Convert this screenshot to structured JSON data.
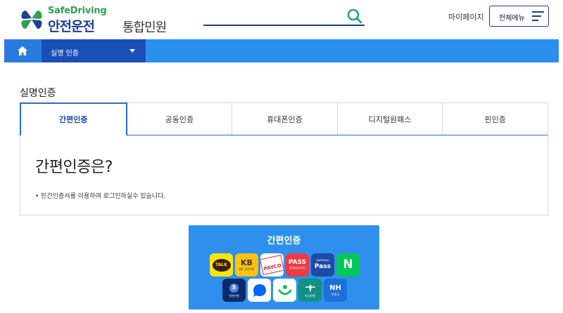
{
  "header": {
    "logo_en": "SafeDriving",
    "logo_ko": "안전운전",
    "logo_sub": "통합민원",
    "mypage_label": "마이페이지",
    "allmenu_label": "전체메뉴"
  },
  "nav": {
    "breadcrumb_label": "실명 인증"
  },
  "page": {
    "title": "실명인증"
  },
  "tabs": [
    {
      "label": "간편인증",
      "active": true
    },
    {
      "label": "공동인증",
      "active": false
    },
    {
      "label": "휴대폰인증",
      "active": false
    },
    {
      "label": "디지털원패스",
      "active": false
    },
    {
      "label": "핀인증",
      "active": false
    }
  ],
  "content": {
    "title": "간편인증은?",
    "desc": "• 민간인증서를 이용하여 로그인하실수 있습니다."
  },
  "panel": {
    "title": "간편인증",
    "apps": [
      {
        "name": "kakao-talk",
        "text": "TALK",
        "bg": "#fee500",
        "fg": "#3c1e1e"
      },
      {
        "name": "kb",
        "text": "KB",
        "sub": "KB 국민은행",
        "bg": "#ffc20e",
        "fg": "#3a3a3a"
      },
      {
        "name": "payco",
        "text": "PAYCO",
        "bg": "#ffffff",
        "fg": "#e52a2a"
      },
      {
        "name": "pass",
        "text": "PASS",
        "sub": "휴대폰본인확인",
        "bg": "#ef3a45",
        "fg": "#ffffff"
      },
      {
        "name": "samsung-pass",
        "text": "Pass",
        "sub": "SAMSUNG",
        "bg": "#1f4aa8",
        "fg": "#ffffff"
      },
      {
        "name": "naver",
        "text": "N",
        "bg": "#03c75a",
        "fg": "#ffffff"
      },
      {
        "name": "shinhan",
        "text": "S",
        "sub": "신한은행",
        "bg": "#0a2a6a",
        "fg": "#ffffff"
      },
      {
        "name": "toss",
        "text": "",
        "bg": "#ffffff",
        "fg": "#0064ff"
      },
      {
        "name": "banksalad",
        "text": "",
        "bg": "#ffffff",
        "fg": "#1fb56b"
      },
      {
        "name": "hana",
        "text": "하나은행",
        "bg": "#119184",
        "fg": "#ffffff"
      },
      {
        "name": "nh",
        "text": "NH",
        "sub": "인증서",
        "bg": "#1e6fd9",
        "fg": "#ffffff"
      }
    ]
  },
  "colors": {
    "brand_navy": "#1f3d93",
    "brand_green": "#2e9e55",
    "nav_blue": "#2b8ff0",
    "nav_dark": "#1a4fba",
    "panel_blue": "#2e90ec",
    "tab_active": "#2a6acb"
  }
}
